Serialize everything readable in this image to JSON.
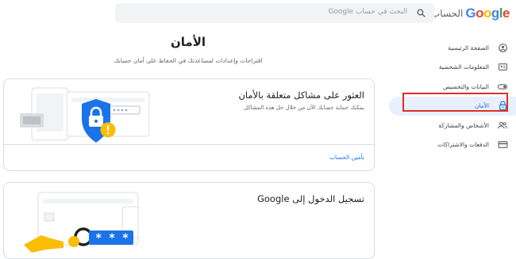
{
  "header": {
    "logo_google": "Google",
    "logo_account": "الحساب",
    "search_placeholder": "البحث في حساب Google"
  },
  "sidebar": {
    "items": [
      {
        "label": "الصفحة الرئيسية",
        "icon": "home-icon"
      },
      {
        "label": "المعلومات الشخصية",
        "icon": "personal-info-icon"
      },
      {
        "label": "البيانات والتخصيص",
        "icon": "toggle-icon"
      },
      {
        "label": "الأمان",
        "icon": "lock-icon",
        "active": true
      },
      {
        "label": "الأشخاص والمشاركة",
        "icon": "people-icon"
      },
      {
        "label": "الدفعات والاشتراكات",
        "icon": "credit-card-icon"
      }
    ]
  },
  "main": {
    "title": "الأمان",
    "subtitle": "اقتراحات وإعدادات لمساعدتك في الحفاظ على أمان حسابك",
    "cards": [
      {
        "title": "العثور على مشاكل متعلقة بالأمان",
        "description": "يمكنك حماية حسابك الآن من خلال حل هذه المشاكل",
        "link": "تأمين الحساب"
      },
      {
        "title": "تسجيل الدخول إلى Google"
      }
    ]
  },
  "colors": {
    "accent_blue": "#1a73e8",
    "highlight_red": "#d93025",
    "shield_blue": "#1a73e8",
    "warning_yellow": "#fbbc04"
  }
}
